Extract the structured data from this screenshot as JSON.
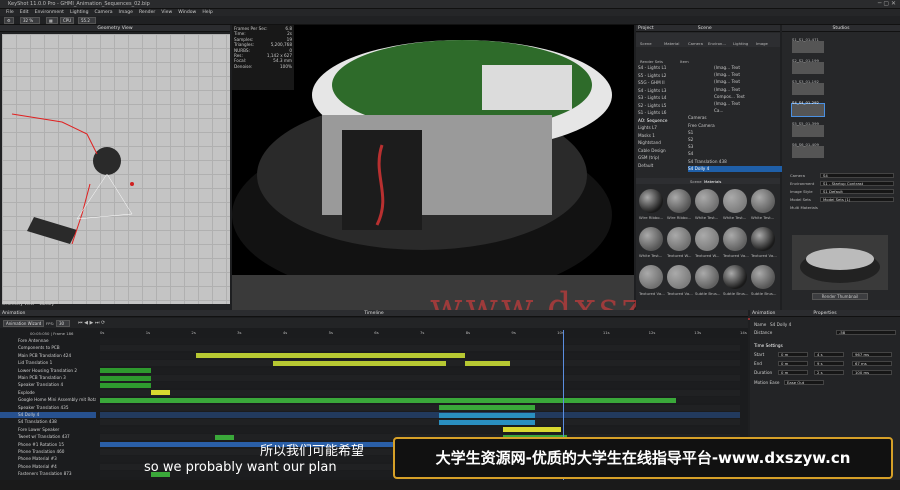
{
  "app": {
    "title": "KeyShot 11.0.0 Pro - GHMI_Animation_Sequences_02.bip"
  },
  "menu": [
    "File",
    "Edit",
    "Environment",
    "Lighting",
    "Camera",
    "Image",
    "Render",
    "View",
    "Window",
    "Help"
  ],
  "toolbar": {
    "zoom": "32 %",
    "cpu": "CPU",
    "num1": "55.2"
  },
  "geometry_view": {
    "title": "Geometry View"
  },
  "render_stats": [
    {
      "k": "Frames Per Sec:",
      "v": "6.8"
    },
    {
      "k": "Time:",
      "v": "2s"
    },
    {
      "k": "Samples:",
      "v": "19"
    },
    {
      "k": "Triangles:",
      "v": "5,200,768"
    },
    {
      "k": "NURBS:",
      "v": "0"
    },
    {
      "k": "Res:",
      "v": "1,142 x 627"
    },
    {
      "k": "Focal:",
      "v": "54.3 mm"
    },
    {
      "k": "Denoise:",
      "v": "100%"
    }
  ],
  "watermark": "www.dxszyw.cn",
  "scene": {
    "header": "Scene",
    "project_label": "Project",
    "tabs": [
      "Scene",
      "Material",
      "Camera",
      "Environ...",
      "Lighting",
      "Image"
    ],
    "sub": [
      "Render Sets",
      "Item"
    ],
    "render_sets": [
      "S4 - Lights L1",
      "S5 - Lights L2",
      "S5G - GHM II",
      "S4 - Lights L3",
      "S3 - Lights L4",
      "S2 - Lights L5",
      "S1 - Lights L6",
      "AO: Sequence",
      "Lights L7",
      "Masks 1",
      "Nightstand",
      "Cable Design",
      "GSM (trip)",
      "Default"
    ],
    "items": [
      "(Imag... Text",
      "(Imag... Text",
      "(Imag... Text",
      "(Imag... Text",
      "Compos... Text",
      "(Imag... Text",
      "Ca...",
      "Cameras",
      "Free Camera",
      "S1",
      "S2",
      "S3",
      "S4",
      "S4 Translation 438",
      "S4 Dolly 4"
    ],
    "lib_tabs": [
      "Scene",
      "Materials"
    ],
    "materials": [
      "Wire Ribbo...",
      "Wire Ribbo...",
      "White Test...",
      "White Test...",
      "White Test...",
      "White Test...",
      "Textured W...",
      "Textured W...",
      "Textured Va...",
      "Textured Va...",
      "Textured Va...",
      "Textured Va...",
      "Subtle Brus...",
      "Subtle Brus...",
      "Subtle Brus..."
    ]
  },
  "studios": {
    "title": "Studios",
    "items": [
      "S1_S1_01-471",
      "S2_S2_01-199",
      "S3_S3_01-192",
      "S4_S4_01-292",
      "S5_S5_01-399",
      "S6_S6_01-409"
    ],
    "fields": [
      {
        "k": "Camera",
        "v": "S4"
      },
      {
        "k": "Environment",
        "v": "S1 - Startup Contrast"
      },
      {
        "k": "Image Style",
        "v": "S1 Default"
      },
      {
        "k": "Model Sets",
        "v": "Model Sets (1)"
      },
      {
        "k": "Multi Materials",
        "v": ""
      }
    ],
    "button": "Render Thumbnail"
  },
  "timeline": {
    "title": "Timeline",
    "animation_label": "Animation",
    "wizard": "Animation Wizard",
    "fps_label": "FPS:",
    "fps": "30",
    "time": "00:05:050 | Frame 186",
    "ticks": [
      "0s",
      "1s",
      "2s",
      "3s",
      "4s",
      "5s",
      "6s",
      "7s",
      "8s",
      "9s",
      "10s",
      "11s",
      "12s",
      "13s",
      "14s"
    ],
    "rows": [
      {
        "name": "Fore Antennae",
        "bars": []
      },
      {
        "name": "Components to PCB",
        "bars": []
      },
      {
        "name": "Main PCB Translation 424",
        "bars": [
          {
            "s": 0.15,
            "e": 0.32,
            "c": "#b7c832"
          },
          {
            "s": 0.32,
            "e": 0.57,
            "c": "#b7c832"
          }
        ]
      },
      {
        "name": "Lid Translation 1",
        "bars": [
          {
            "s": 0.27,
            "e": 0.33,
            "c": "#b7c832"
          },
          {
            "s": 0.32,
            "e": 0.54,
            "c": "#b7c832"
          },
          {
            "s": 0.57,
            "e": 0.64,
            "c": "#b7c832"
          }
        ]
      },
      {
        "name": "Lower Housing Translation 2",
        "bars": [
          {
            "s": 0,
            "e": 0.08,
            "c": "#2e9a2e"
          }
        ]
      },
      {
        "name": "Main PCB Translation 3",
        "bars": [
          {
            "s": 0,
            "e": 0.08,
            "c": "#2e9a2e"
          }
        ]
      },
      {
        "name": "Speaker Translation 4",
        "bars": [
          {
            "s": 0,
            "e": 0.08,
            "c": "#2e9a2e"
          }
        ]
      },
      {
        "name": "Explode",
        "bars": [
          {
            "s": 0.08,
            "e": 0.11,
            "c": "#d8d830"
          }
        ]
      },
      {
        "name": "Google Home Mini Assembly mit Rotatio...",
        "bars": [
          {
            "s": 0,
            "e": 0.9,
            "c": "#3aa83a"
          }
        ]
      },
      {
        "name": "Speaker Translation 435",
        "bars": [
          {
            "s": 0.53,
            "e": 0.68,
            "c": "#3aa83a"
          }
        ]
      },
      {
        "name": "S4 Dolly 4",
        "bars": [
          {
            "s": 0.53,
            "e": 0.68,
            "c": "#2a8fc0"
          }
        ]
      },
      {
        "name": "S4 Translation 438",
        "bars": [
          {
            "s": 0.53,
            "e": 0.68,
            "c": "#2a8fc0"
          }
        ]
      },
      {
        "name": "Fore Lower Speaker",
        "bars": [
          {
            "s": 0.63,
            "e": 0.72,
            "c": "#d8d830"
          }
        ]
      },
      {
        "name": "Tweet w/ Translation 437",
        "bars": [
          {
            "s": 0.18,
            "e": 0.21,
            "c": "#3aa83a"
          },
          {
            "s": 0.63,
            "e": 0.73,
            "c": "#3aa83a"
          }
        ]
      },
      {
        "name": "Phone #1 Rotation 15",
        "bars": [
          {
            "s": 0,
            "e": 1,
            "c": "#2a5fa8"
          }
        ]
      },
      {
        "name": "Phone Translation 460",
        "bars": []
      },
      {
        "name": "Phone Material #3",
        "bars": []
      },
      {
        "name": "Phone Material #4",
        "bars": []
      },
      {
        "name": "Fasteners Translation 873",
        "bars": [
          {
            "s": 0.08,
            "e": 0.11,
            "c": "#3aa83a"
          }
        ]
      }
    ]
  },
  "properties": {
    "title": "Properties",
    "anim_label": "Animation",
    "name_label": "Name",
    "name_value": "S4 Dolly 4",
    "distance_label": "Distance",
    "distance_value": "-58",
    "section": "Time Settings",
    "rows": [
      {
        "k": "Start",
        "a": "0 m",
        "b": "4 s",
        "c": "967 ms"
      },
      {
        "k": "End",
        "a": "0 m",
        "b": "9 s",
        "c": "67 ms"
      },
      {
        "k": "Duration",
        "a": "0 m",
        "b": "2 s",
        "c": "100 ms"
      }
    ],
    "motion_label": "Motion Ease",
    "motion_value": "Ease Out"
  },
  "subtitles": {
    "cn": "所以我们可能希望",
    "en": "so we probably want our plan"
  },
  "banner": "大学生资源网-优质的大学生在线指导平台-www.dxszyw.cn",
  "tabs_bottom": [
    "Geometry View",
    "Library"
  ]
}
